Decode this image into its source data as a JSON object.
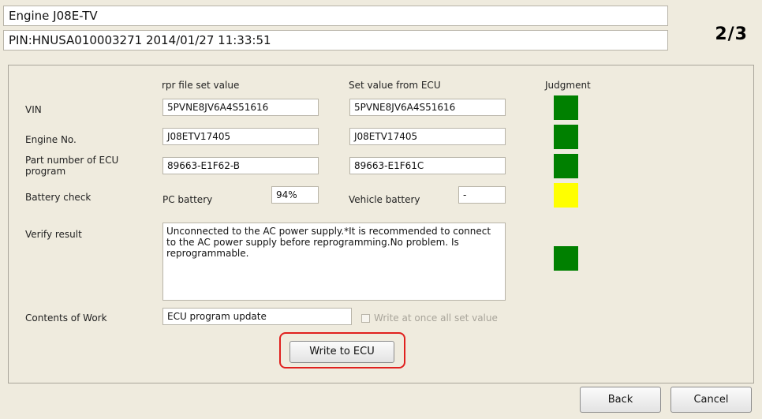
{
  "header": {
    "title": "Engine J08E-TV",
    "pin_line": "PIN:HNUSA010003271 2014/01/27 11:33:51",
    "step": "2/3"
  },
  "columns": {
    "rpr": "rpr file set value",
    "ecu": "Set value from ECU",
    "judgment": "Judgment"
  },
  "rows": {
    "vin": {
      "label": "VIN",
      "rpr": "5PVNE8JV6A4S51616",
      "ecu": "5PVNE8JV6A4S51616",
      "judgment": "ok"
    },
    "engine": {
      "label": "Engine No.",
      "rpr": "J08ETV17405",
      "ecu": "J08ETV17405",
      "judgment": "ok"
    },
    "part": {
      "label": "Part number of ECU program",
      "rpr": "89663-E1F62-B",
      "ecu": "89663-E1F61C",
      "judgment": "ok"
    },
    "battery": {
      "label": "Battery check",
      "pc_label": "PC battery",
      "pc_value": "94%",
      "vehicle_label": "Vehicle battery",
      "vehicle_value": "-",
      "judgment": "warn"
    },
    "verify": {
      "label": "Verify result",
      "text": "Unconnected to the AC power supply.*It is recommended to connect to the AC power supply before reprogramming.No problem. Is reprogrammable.",
      "judgment": "ok"
    },
    "work": {
      "label": "Contents of Work",
      "value": "ECU program update",
      "checkbox_label": "Write at once all set value"
    }
  },
  "buttons": {
    "write": "Write to ECU",
    "back": "Back",
    "cancel": "Cancel"
  },
  "colors": {
    "ok": "#008000",
    "warn": "#ffff00",
    "highlight": "#e0201e"
  }
}
